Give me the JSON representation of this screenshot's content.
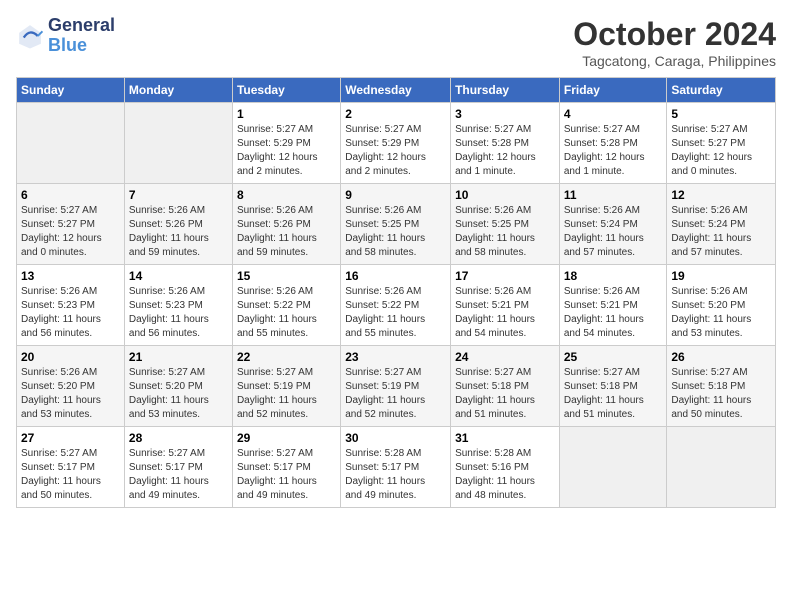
{
  "header": {
    "logo_line1": "General",
    "logo_line2": "Blue",
    "month": "October 2024",
    "location": "Tagcatong, Caraga, Philippines"
  },
  "weekdays": [
    "Sunday",
    "Monday",
    "Tuesday",
    "Wednesday",
    "Thursday",
    "Friday",
    "Saturday"
  ],
  "weeks": [
    [
      {
        "num": "",
        "detail": ""
      },
      {
        "num": "",
        "detail": ""
      },
      {
        "num": "1",
        "detail": "Sunrise: 5:27 AM\nSunset: 5:29 PM\nDaylight: 12 hours\nand 2 minutes."
      },
      {
        "num": "2",
        "detail": "Sunrise: 5:27 AM\nSunset: 5:29 PM\nDaylight: 12 hours\nand 2 minutes."
      },
      {
        "num": "3",
        "detail": "Sunrise: 5:27 AM\nSunset: 5:28 PM\nDaylight: 12 hours\nand 1 minute."
      },
      {
        "num": "4",
        "detail": "Sunrise: 5:27 AM\nSunset: 5:28 PM\nDaylight: 12 hours\nand 1 minute."
      },
      {
        "num": "5",
        "detail": "Sunrise: 5:27 AM\nSunset: 5:27 PM\nDaylight: 12 hours\nand 0 minutes."
      }
    ],
    [
      {
        "num": "6",
        "detail": "Sunrise: 5:27 AM\nSunset: 5:27 PM\nDaylight: 12 hours\nand 0 minutes."
      },
      {
        "num": "7",
        "detail": "Sunrise: 5:26 AM\nSunset: 5:26 PM\nDaylight: 11 hours\nand 59 minutes."
      },
      {
        "num": "8",
        "detail": "Sunrise: 5:26 AM\nSunset: 5:26 PM\nDaylight: 11 hours\nand 59 minutes."
      },
      {
        "num": "9",
        "detail": "Sunrise: 5:26 AM\nSunset: 5:25 PM\nDaylight: 11 hours\nand 58 minutes."
      },
      {
        "num": "10",
        "detail": "Sunrise: 5:26 AM\nSunset: 5:25 PM\nDaylight: 11 hours\nand 58 minutes."
      },
      {
        "num": "11",
        "detail": "Sunrise: 5:26 AM\nSunset: 5:24 PM\nDaylight: 11 hours\nand 57 minutes."
      },
      {
        "num": "12",
        "detail": "Sunrise: 5:26 AM\nSunset: 5:24 PM\nDaylight: 11 hours\nand 57 minutes."
      }
    ],
    [
      {
        "num": "13",
        "detail": "Sunrise: 5:26 AM\nSunset: 5:23 PM\nDaylight: 11 hours\nand 56 minutes."
      },
      {
        "num": "14",
        "detail": "Sunrise: 5:26 AM\nSunset: 5:23 PM\nDaylight: 11 hours\nand 56 minutes."
      },
      {
        "num": "15",
        "detail": "Sunrise: 5:26 AM\nSunset: 5:22 PM\nDaylight: 11 hours\nand 55 minutes."
      },
      {
        "num": "16",
        "detail": "Sunrise: 5:26 AM\nSunset: 5:22 PM\nDaylight: 11 hours\nand 55 minutes."
      },
      {
        "num": "17",
        "detail": "Sunrise: 5:26 AM\nSunset: 5:21 PM\nDaylight: 11 hours\nand 54 minutes."
      },
      {
        "num": "18",
        "detail": "Sunrise: 5:26 AM\nSunset: 5:21 PM\nDaylight: 11 hours\nand 54 minutes."
      },
      {
        "num": "19",
        "detail": "Sunrise: 5:26 AM\nSunset: 5:20 PM\nDaylight: 11 hours\nand 53 minutes."
      }
    ],
    [
      {
        "num": "20",
        "detail": "Sunrise: 5:26 AM\nSunset: 5:20 PM\nDaylight: 11 hours\nand 53 minutes."
      },
      {
        "num": "21",
        "detail": "Sunrise: 5:27 AM\nSunset: 5:20 PM\nDaylight: 11 hours\nand 53 minutes."
      },
      {
        "num": "22",
        "detail": "Sunrise: 5:27 AM\nSunset: 5:19 PM\nDaylight: 11 hours\nand 52 minutes."
      },
      {
        "num": "23",
        "detail": "Sunrise: 5:27 AM\nSunset: 5:19 PM\nDaylight: 11 hours\nand 52 minutes."
      },
      {
        "num": "24",
        "detail": "Sunrise: 5:27 AM\nSunset: 5:18 PM\nDaylight: 11 hours\nand 51 minutes."
      },
      {
        "num": "25",
        "detail": "Sunrise: 5:27 AM\nSunset: 5:18 PM\nDaylight: 11 hours\nand 51 minutes."
      },
      {
        "num": "26",
        "detail": "Sunrise: 5:27 AM\nSunset: 5:18 PM\nDaylight: 11 hours\nand 50 minutes."
      }
    ],
    [
      {
        "num": "27",
        "detail": "Sunrise: 5:27 AM\nSunset: 5:17 PM\nDaylight: 11 hours\nand 50 minutes."
      },
      {
        "num": "28",
        "detail": "Sunrise: 5:27 AM\nSunset: 5:17 PM\nDaylight: 11 hours\nand 49 minutes."
      },
      {
        "num": "29",
        "detail": "Sunrise: 5:27 AM\nSunset: 5:17 PM\nDaylight: 11 hours\nand 49 minutes."
      },
      {
        "num": "30",
        "detail": "Sunrise: 5:28 AM\nSunset: 5:17 PM\nDaylight: 11 hours\nand 49 minutes."
      },
      {
        "num": "31",
        "detail": "Sunrise: 5:28 AM\nSunset: 5:16 PM\nDaylight: 11 hours\nand 48 minutes."
      },
      {
        "num": "",
        "detail": ""
      },
      {
        "num": "",
        "detail": ""
      }
    ]
  ]
}
